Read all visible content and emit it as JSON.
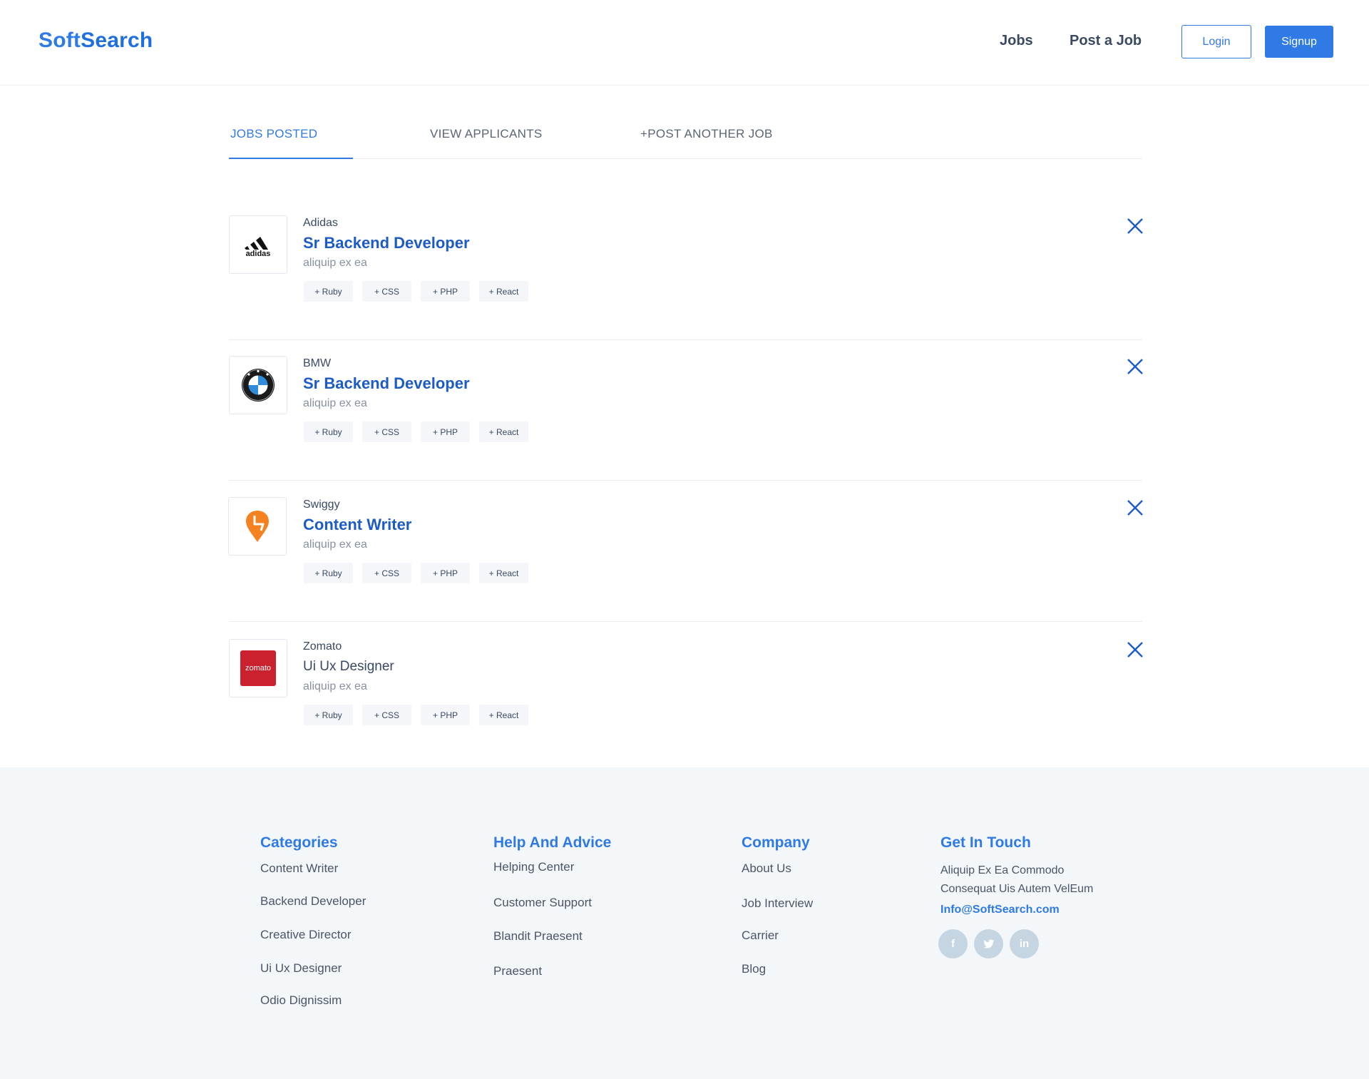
{
  "header": {
    "logo_part1": "Soft",
    "logo_part2": "Search",
    "nav": [
      {
        "label": "Jobs"
      },
      {
        "label": "Post a Job"
      }
    ],
    "login_label": "Login",
    "signup_label": "Signup",
    "accent_color": "#2f7ae5"
  },
  "tabs": [
    {
      "label": "JOBS POSTED",
      "active": true
    },
    {
      "label": "VIEW APPLICANTS",
      "active": false
    },
    {
      "label": "+POST ANOTHER JOB",
      "active": false
    }
  ],
  "jobs": [
    {
      "company": "Adidas",
      "title": "Sr Backend Developer",
      "subtitle": "aliquip ex ea",
      "tags": [
        "+ Ruby",
        "+ CSS",
        "+ PHP",
        "+ React"
      ],
      "logo_icon": "adidas-logo"
    },
    {
      "company": "BMW",
      "title": "Sr Backend Developer",
      "subtitle": "aliquip ex ea",
      "tags": [
        "+ Ruby",
        "+ CSS",
        "+ PHP",
        "+ React"
      ],
      "logo_icon": "bmw-logo"
    },
    {
      "company": "Swiggy",
      "title": "Content Writer",
      "subtitle": "aliquip ex ea",
      "tags": [
        "+ Ruby",
        "+ CSS",
        "+ PHP",
        "+ React"
      ],
      "logo_icon": "swiggy-logo"
    },
    {
      "company": "Zomato",
      "title": "Ui Ux Designer",
      "subtitle": "aliquip ex ea",
      "tags": [
        "+ Ruby",
        "+ CSS",
        "+ PHP",
        "+ React"
      ],
      "logo_icon": "zomato-logo",
      "logo_text": "zomato"
    }
  ],
  "footer": {
    "categories": {
      "heading": "Categories",
      "items": [
        "Content Writer",
        "Backend Developer",
        "Creative Director",
        "Ui Ux Designer",
        "Odio Dignissim"
      ]
    },
    "help": {
      "heading": "Help And Advice",
      "items": [
        "Helping Center",
        "Customer Support",
        "Blandit Praesent",
        "Praesent"
      ]
    },
    "company": {
      "heading": "Company",
      "items": [
        "About Us",
        "Job Interview",
        "Carrier",
        "Blog"
      ]
    },
    "contact": {
      "heading": "Get In Touch",
      "address_line1": "Aliquip Ex Ea Commodo",
      "address_line2": "Consequat Uis Autem VelEum",
      "email": "Info@SoftSearch.com",
      "socials": [
        {
          "icon": "facebook-icon",
          "glyph": "f"
        },
        {
          "icon": "twitter-icon",
          "glyph": "t"
        },
        {
          "icon": "linkedin-icon",
          "glyph": "in"
        }
      ]
    }
  }
}
